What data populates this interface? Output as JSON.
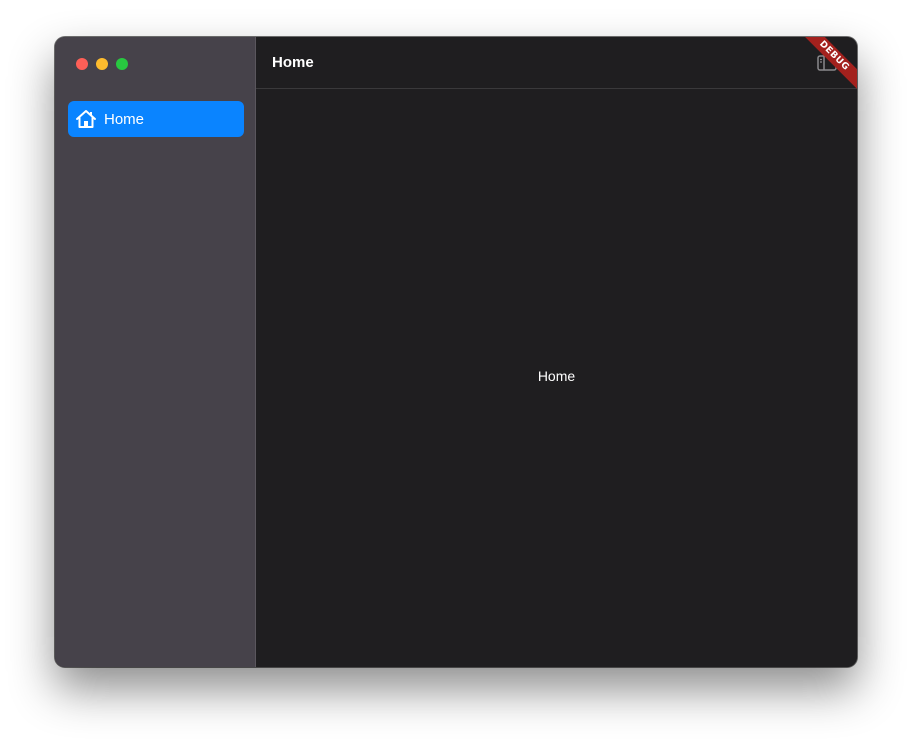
{
  "colors": {
    "accent": "#0a84ff",
    "sidebar_bg": "#46424a",
    "main_bg": "#1f1e20",
    "debug_banner": "#a3211d"
  },
  "window": {
    "traffic_lights": [
      "close",
      "minimize",
      "zoom"
    ]
  },
  "sidebar": {
    "items": [
      {
        "label": "Home",
        "icon": "house-icon",
        "selected": true
      }
    ]
  },
  "header": {
    "title": "Home",
    "toggle_icon": "sidebar-toggle-icon"
  },
  "main": {
    "content_text": "Home"
  },
  "debug_banner": {
    "text": "DEBUG"
  }
}
